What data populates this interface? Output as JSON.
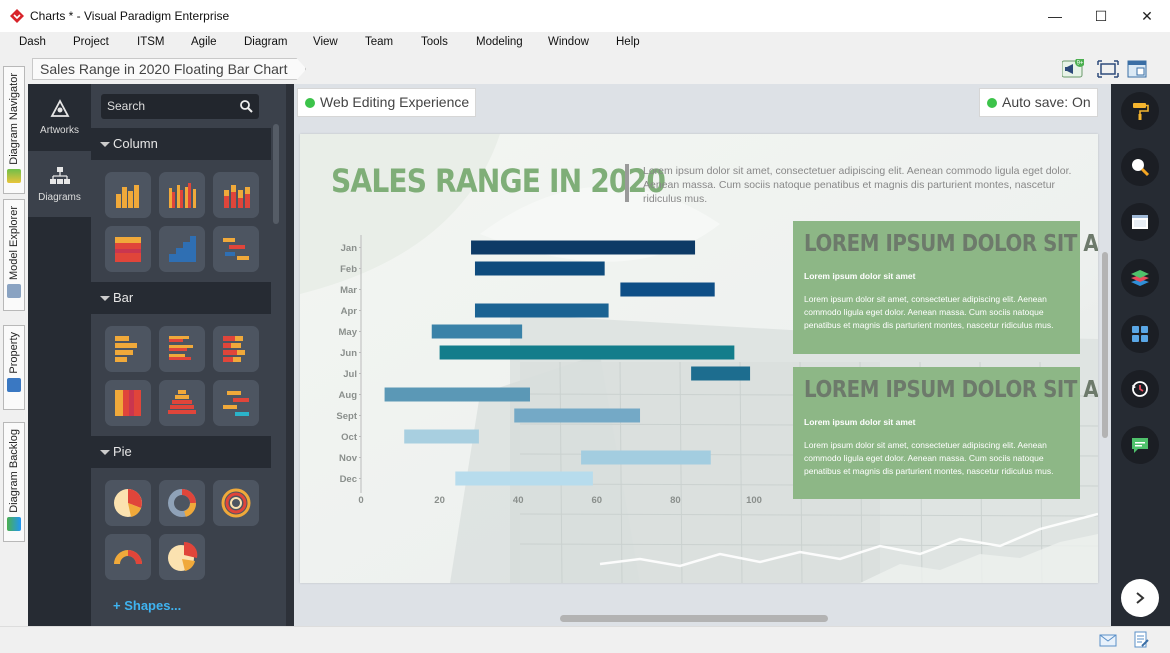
{
  "window": {
    "title": "Charts * - Visual Paradigm Enterprise",
    "minimize": "—",
    "maximize": "☐",
    "close": "✕"
  },
  "menu": [
    "Dash",
    "Project",
    "ITSM",
    "Agile",
    "Diagram",
    "View",
    "Team",
    "Tools",
    "Modeling",
    "Window",
    "Help"
  ],
  "breadcrumb": "Sales Range in 2020 Floating Bar Chart",
  "notification_badge": "9+",
  "left_tabs": [
    "Diagram Navigator",
    "Model Explorer",
    "Property",
    "Diagram Backlog"
  ],
  "nav": {
    "artworks": "Artworks",
    "diagrams": "Diagrams"
  },
  "palette": {
    "search_placeholder": "Search",
    "sections": [
      "Column",
      "Bar",
      "Pie"
    ],
    "shapes_link": "+ Shapes..."
  },
  "pills": {
    "web_editing": "Web Editing Experience",
    "autosave": "Auto save: On"
  },
  "slide": {
    "title": "SALES RANGE IN 2020",
    "description": "Lorem ipsum dolor sit amet, consectetuer adipiscing elit. Aenean commodo ligula eget dolor. Aenean massa. Cum sociis natoque penatibus et magnis dis parturient montes, nascetur ridiculus mus.",
    "cards": [
      {
        "title": "LOREM IPSUM DOLOR SIT AMET",
        "subtitle": "Lorem ipsum dolor sit amet",
        "body": "Lorem ipsum dolor sit amet, consectetuer adipiscing elit. Aenean commodo ligula eget dolor. Aenean massa. Cum sociis natoque penatibus et magnis dis parturient montes, nascetur ridiculus mus."
      },
      {
        "title": "LOREM IPSUM DOLOR SIT AMET",
        "subtitle": "Lorem ipsum dolor sit amet",
        "body": "Lorem ipsum dolor sit amet, consectetuer adipiscing elit. Aenean commodo ligula eget dolor. Aenean massa. Cum sociis natoque penatibus et magnis dis parturient montes, nascetur ridiculus mus."
      }
    ]
  },
  "chart_data": {
    "type": "bar",
    "orientation": "horizontal-floating",
    "categories": [
      "Jan",
      "Feb",
      "Mar",
      "Apr",
      "May",
      "Jun",
      "Jul",
      "Aug",
      "Sept",
      "Oct",
      "Nov",
      "Dec"
    ],
    "ranges": [
      [
        28,
        85
      ],
      [
        29,
        62
      ],
      [
        66,
        90
      ],
      [
        29,
        63
      ],
      [
        18,
        41
      ],
      [
        20,
        95
      ],
      [
        84,
        99
      ],
      [
        6,
        43
      ],
      [
        39,
        71
      ],
      [
        11,
        30
      ],
      [
        56,
        89
      ],
      [
        24,
        59
      ]
    ],
    "colors": [
      "#0d3a66",
      "#0e4b7d",
      "#0e4e86",
      "#1b6393",
      "#3a82a8",
      "#137d8b",
      "#1d6d8f",
      "#5b98b6",
      "#74a9c6",
      "#a8cfe0",
      "#a3cde0",
      "#b7dced"
    ],
    "xticks": [
      0,
      20,
      40,
      60,
      80,
      100
    ],
    "xlim": [
      0,
      100
    ],
    "grid": false
  },
  "colors": {
    "accent_green": "#7fae78",
    "card_green": "#8db786",
    "dark_panel": "#262b33",
    "link_blue": "#3fb3f0"
  }
}
